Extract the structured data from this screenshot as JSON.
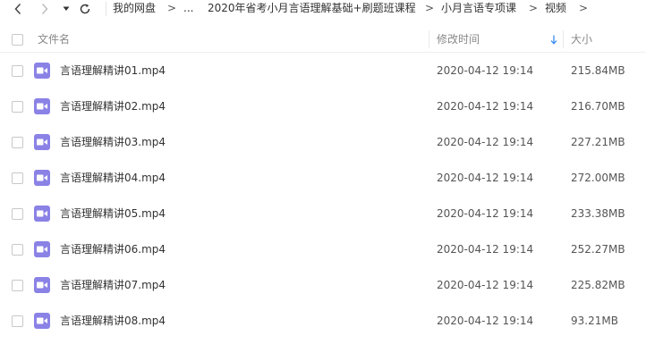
{
  "breadcrumb": {
    "items": [
      "我的网盘",
      "...",
      "2020年省考小月言语理解基础+刷题班课程",
      "小月言语专项课",
      "视频"
    ],
    "separator": ">"
  },
  "icons": {
    "back": "chevron-left-icon",
    "forward": "chevron-right-icon",
    "history": "caret-down-icon",
    "refresh": "refresh-icon",
    "file": "video-file-icon",
    "sort": "arrow-down-icon"
  },
  "colors": {
    "file_icon": "#8b82e6",
    "sort_arrow": "#3b8cf0"
  },
  "table": {
    "headers": {
      "name": "文件名",
      "modified": "修改时间",
      "size": "大小"
    },
    "sort_column": "modified",
    "rows": [
      {
        "name": "言语理解精讲01.mp4",
        "modified": "2020-04-12 19:14",
        "size": "215.84MB"
      },
      {
        "name": "言语理解精讲02.mp4",
        "modified": "2020-04-12 19:14",
        "size": "216.70MB"
      },
      {
        "name": "言语理解精讲03.mp4",
        "modified": "2020-04-12 19:14",
        "size": "227.21MB"
      },
      {
        "name": "言语理解精讲04.mp4",
        "modified": "2020-04-12 19:14",
        "size": "272.00MB"
      },
      {
        "name": "言语理解精讲05.mp4",
        "modified": "2020-04-12 19:14",
        "size": "233.38MB"
      },
      {
        "name": "言语理解精讲06.mp4",
        "modified": "2020-04-12 19:14",
        "size": "252.27MB"
      },
      {
        "name": "言语理解精讲07.mp4",
        "modified": "2020-04-12 19:14",
        "size": "225.82MB"
      },
      {
        "name": "言语理解精讲08.mp4",
        "modified": "2020-04-12 19:14",
        "size": "93.21MB"
      }
    ]
  }
}
